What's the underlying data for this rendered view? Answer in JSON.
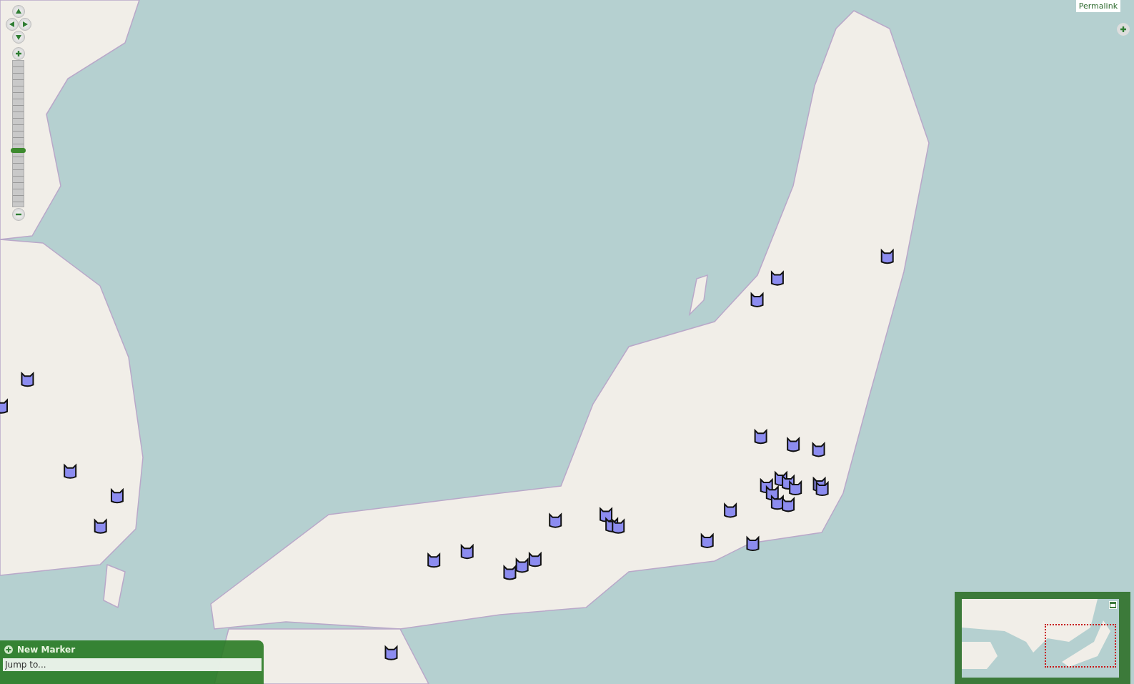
{
  "permalink": "Permalink",
  "zoom": {
    "level": 0.39
  },
  "marker_panel": {
    "title": "New Marker",
    "search": {
      "placeholder": "Jump to..."
    }
  }
}
